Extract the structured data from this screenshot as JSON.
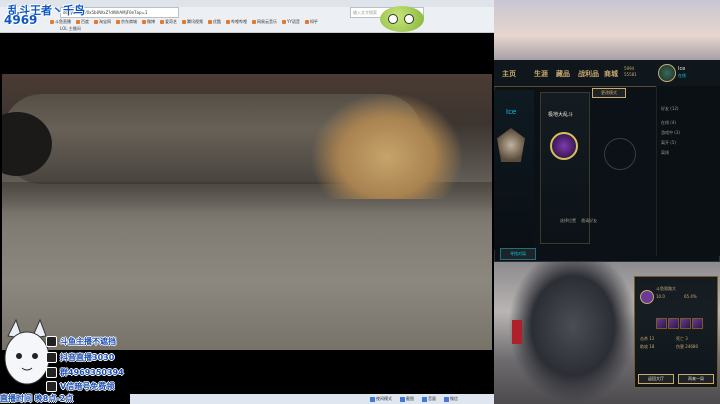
{
  "browser": {
    "address": "douyu.com/0x5b0WxZ?dlWrAMjF0e7ap=1",
    "search_placeholder": "输入文字搜索",
    "bookmarks": [
      "斗鱼直播",
      "百度",
      "淘宝网",
      "京东商城",
      "微博",
      "爱奇艺",
      "腾讯视频",
      "优酷",
      "哔哩哔哩",
      "网易云音乐",
      "YY语音",
      "知乎"
    ],
    "tab_label": "LOL 主播间"
  },
  "stream_overlay": {
    "title": "乱斗王者丶千鸟",
    "room_id": "4969",
    "lines": [
      "斗鱼主播不遮挡",
      "抖音直播3030",
      "群4969350394",
      "V信暗号免费领"
    ],
    "ticker": "直播时间 晚8点-2点"
  },
  "taskbar": {
    "items": [
      "夜间模式",
      "截图",
      "音量",
      "微信",
      "时间"
    ]
  },
  "lol_client": {
    "nav": [
      "主页",
      "生涯",
      "藏品",
      "战利品",
      "商城"
    ],
    "currency_rp": "5994",
    "currency_be": "55581",
    "player_name": "Ice",
    "player_status": "在线",
    "rank_label": "Ice",
    "slot_name": "极地大乱斗",
    "mode_button": "更改模式",
    "find_button": "寻找对局",
    "confirm_labels": [
      "选择位置",
      "邀请好友"
    ],
    "friends": [
      "好友 (12)",
      "在线 (4)",
      "游戏中 (3)",
      "离开 (5)",
      "离线"
    ]
  },
  "game_panel": {
    "title": "斗鱼恩路大",
    "stats": [
      "击杀 12",
      "死亡 3",
      "助攻 18",
      "伤害 24680"
    ],
    "kda": "10.0",
    "percent": "65.4%",
    "btn_left": "返回大厅",
    "btn_right": "再来一局"
  },
  "colors": {
    "lol_gold": "#c8aa6e",
    "lol_teal": "#0acbe6",
    "overlay_blue": "#1a4fb8"
  }
}
